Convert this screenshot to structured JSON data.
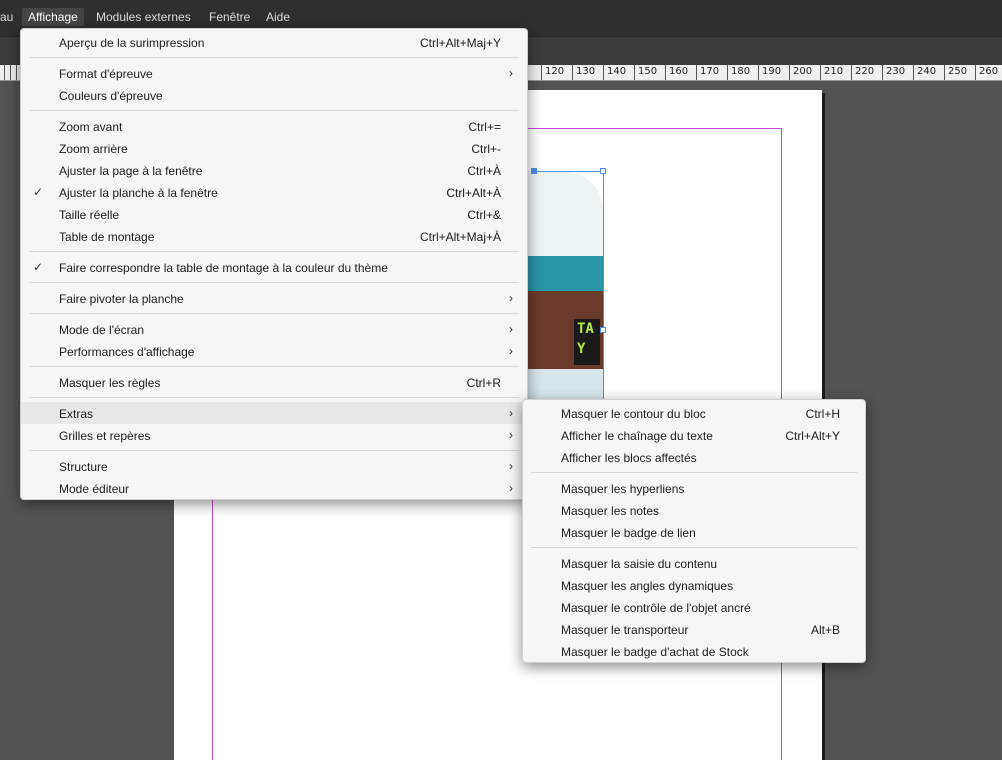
{
  "menubar": {
    "items": [
      {
        "label": "au",
        "active": false
      },
      {
        "label": "Affichage",
        "active": true
      },
      {
        "label": "Modules externes",
        "active": false
      },
      {
        "label": "Fenêtre",
        "active": false
      },
      {
        "label": "Aide",
        "active": false
      }
    ]
  },
  "ruler": {
    "labels": [
      "120",
      "130",
      "140",
      "150",
      "160",
      "170",
      "180",
      "190",
      "200",
      "210",
      "220",
      "230",
      "240",
      "250",
      "260"
    ]
  },
  "main_menu": {
    "items": [
      {
        "label": "Aperçu de la surimpression",
        "shortcut": "Ctrl+Alt+Maj+Y"
      },
      {
        "label": "Format d'épreuve",
        "arrow": "›"
      },
      {
        "label": "Couleurs d'épreuve"
      },
      {
        "label": "Zoom avant",
        "shortcut": "Ctrl+="
      },
      {
        "label": "Zoom arrière",
        "shortcut": "Ctrl+-"
      },
      {
        "label": "Ajuster la page à la fenêtre",
        "shortcut": "Ctrl+À"
      },
      {
        "label": "Ajuster la planche à la fenêtre",
        "shortcut": "Ctrl+Alt+À",
        "check": "✓"
      },
      {
        "label": "Taille réelle",
        "shortcut": "Ctrl+&"
      },
      {
        "label": "Table de montage",
        "shortcut": "Ctrl+Alt+Maj+À"
      },
      {
        "label": "Faire correspondre la table de montage à la couleur du thème",
        "check": "✓"
      },
      {
        "label": "Faire pivoter la planche",
        "arrow": "›"
      },
      {
        "label": "Mode de l'écran",
        "arrow": "›"
      },
      {
        "label": "Performances d'affichage",
        "arrow": "›"
      },
      {
        "label": "Masquer les règles",
        "shortcut": "Ctrl+R"
      },
      {
        "label": "Extras",
        "arrow": "›"
      },
      {
        "label": "Grilles et repères",
        "arrow": "›"
      },
      {
        "label": "Structure",
        "arrow": "›"
      },
      {
        "label": "Mode éditeur",
        "arrow": "›"
      }
    ]
  },
  "extras_submenu": {
    "items": [
      {
        "label": "Masquer le contour du bloc",
        "shortcut": "Ctrl+H"
      },
      {
        "label": "Afficher le chaînage du texte",
        "shortcut": "Ctrl+Alt+Y"
      },
      {
        "label": "Afficher les blocs affectés"
      },
      {
        "label": "Masquer les hyperliens"
      },
      {
        "label": "Masquer les notes"
      },
      {
        "label": "Masquer le badge de lien"
      },
      {
        "label": "Masquer la saisie du contenu"
      },
      {
        "label": "Masquer les angles dynamiques"
      },
      {
        "label": "Masquer le contrôle de l'objet ancré"
      },
      {
        "label": "Masquer le transporteur",
        "shortcut": "Alt+B"
      },
      {
        "label": "Masquer le badge d'achat de Stock"
      }
    ]
  },
  "artwork": {
    "sign_text": "TA\nY"
  }
}
